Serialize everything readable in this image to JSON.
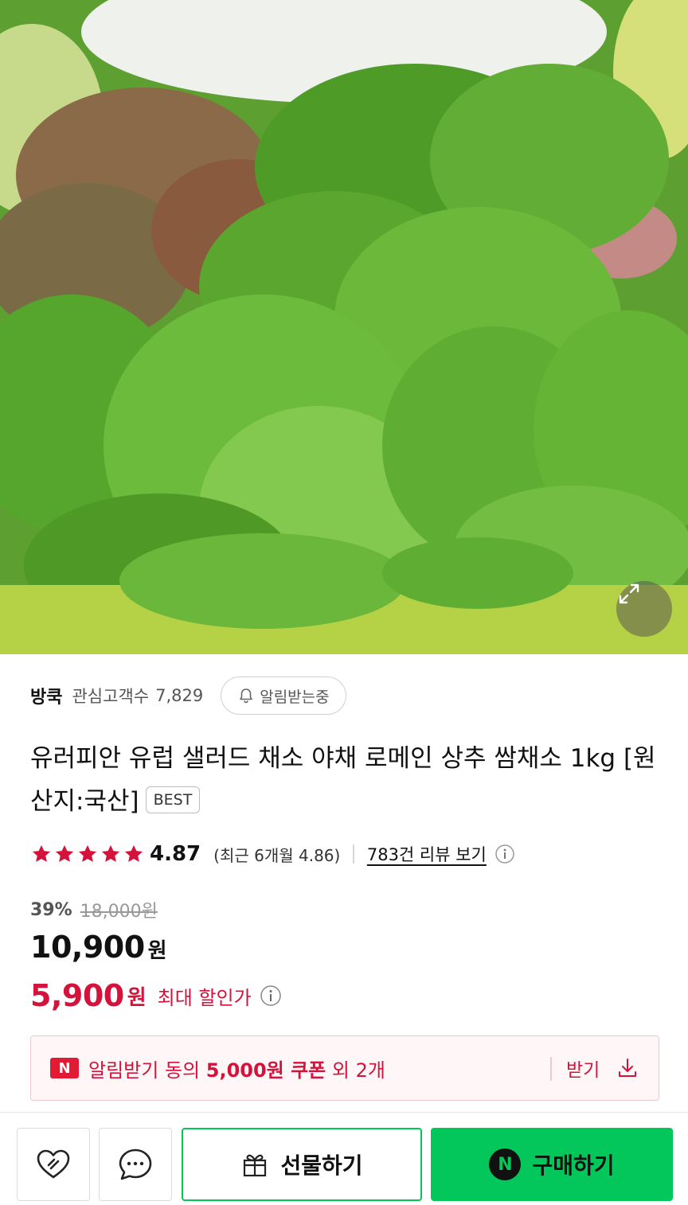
{
  "hero": {
    "image_description_icon": "expand-icon"
  },
  "seller": {
    "store_name": "방쿡",
    "interest_label": "관심고객수",
    "interest_count": "7,829",
    "alarm_label": "알림받는중",
    "alarm_icon": "bell-icon"
  },
  "product": {
    "title": "유러피안 유럽 샐러드 채소 야채 로메인 상추 쌈채소 1kg [원산지:국산]",
    "badge": "BEST"
  },
  "rating": {
    "stars": 5,
    "score": "4.87",
    "recent": "(최근 6개월 4.86)",
    "review_link": "783건 리뷰 보기",
    "star_color": "#d4123b"
  },
  "price": {
    "discount_rate": "39%",
    "original": "18,000원",
    "sale": "10,900",
    "sale_unit": "원",
    "max_discount": "5,900",
    "max_unit": "원",
    "max_label": "최대 할인가"
  },
  "coupon": {
    "badge": "N",
    "text_prefix": "알림받기 동의 ",
    "text_bold": "5,000원 쿠폰",
    "text_suffix": " 외 2개",
    "get_label": "받기",
    "get_icon": "download-icon"
  },
  "bottom_bar": {
    "wishlist_icon": "heart-icon",
    "chat_icon": "chat-icon",
    "gift_label": "선물하기",
    "gift_icon": "gift-icon",
    "buy_label": "구매하기",
    "buy_badge": "N",
    "accent_color": "#03c75a"
  }
}
